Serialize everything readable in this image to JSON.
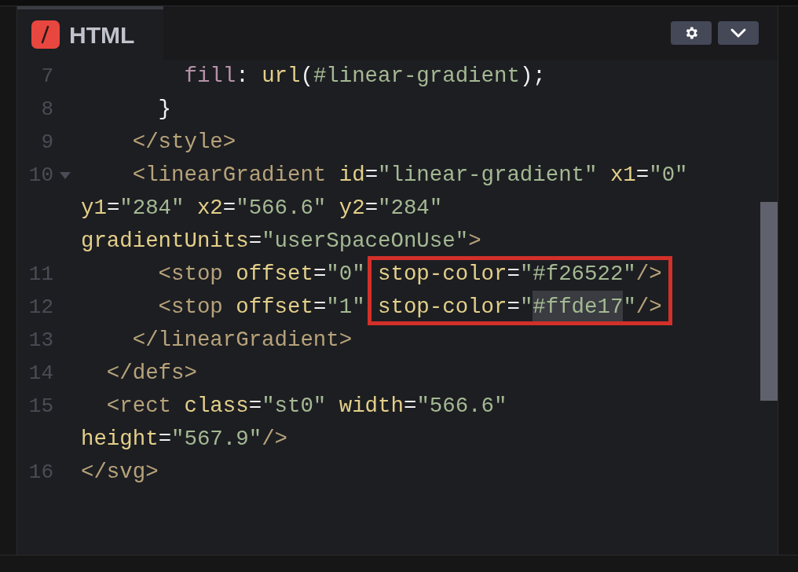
{
  "tab": {
    "label": "HTML",
    "selected": true
  },
  "toolbar": [
    {
      "kind": "settings"
    },
    {
      "kind": "collapse"
    }
  ],
  "lines": [
    {
      "number": "7",
      "tokens": [
        {
          "kind": "property",
          "text": "        fill"
        },
        {
          "kind": "punct",
          "text": ": "
        },
        {
          "kind": "func",
          "text": "url"
        },
        {
          "kind": "punct",
          "text": "("
        },
        {
          "kind": "string",
          "text": "#linear-gradient"
        },
        {
          "kind": "punct",
          "text": ");"
        }
      ]
    },
    {
      "number": "8",
      "tokens": [
        {
          "kind": "punct",
          "text": "      }"
        }
      ]
    },
    {
      "number": "9",
      "tokens": [
        {
          "kind": "tag",
          "text": "    </style>"
        }
      ]
    },
    {
      "number": "10",
      "foldable": true,
      "tokens": [
        {
          "kind": "tag",
          "text": "    <linearGradient "
        },
        {
          "kind": "attr",
          "text": "id"
        },
        {
          "kind": "punct",
          "text": "="
        },
        {
          "kind": "string",
          "text": "\"linear-gradient\" "
        },
        {
          "kind": "attr",
          "text": "x1"
        },
        {
          "kind": "punct",
          "text": "="
        },
        {
          "kind": "string",
          "text": "\"0\""
        }
      ]
    },
    {
      "tokens": [
        {
          "kind": "attr",
          "text": "y1"
        },
        {
          "kind": "punct",
          "text": "="
        },
        {
          "kind": "string",
          "text": "\"284\" "
        },
        {
          "kind": "attr",
          "text": "x2"
        },
        {
          "kind": "punct",
          "text": "="
        },
        {
          "kind": "string",
          "text": "\"566.6\" "
        },
        {
          "kind": "attr",
          "text": "y2"
        },
        {
          "kind": "punct",
          "text": "="
        },
        {
          "kind": "string",
          "text": "\"284\""
        }
      ]
    },
    {
      "tokens": [
        {
          "kind": "attr",
          "text": "gradientUnits"
        },
        {
          "kind": "punct",
          "text": "="
        },
        {
          "kind": "string",
          "text": "\"userSpaceOnUse\""
        },
        {
          "kind": "tag",
          "text": ">"
        }
      ]
    },
    {
      "number": "11",
      "tokens": [
        {
          "kind": "tag",
          "text": "      <stop "
        },
        {
          "kind": "attr",
          "text": "offset"
        },
        {
          "kind": "punct",
          "text": "="
        },
        {
          "kind": "string",
          "text": "\"0\" "
        }
      ],
      "boxed_tokens": [
        {
          "kind": "attr",
          "text": "stop-color"
        },
        {
          "kind": "punct",
          "text": "="
        },
        {
          "kind": "string",
          "text": "\"#f26522\""
        },
        {
          "kind": "tag",
          "text": "/>"
        }
      ]
    },
    {
      "number": "12",
      "tokens": [
        {
          "kind": "tag",
          "text": "      <stop "
        },
        {
          "kind": "attr",
          "text": "offset"
        },
        {
          "kind": "punct",
          "text": "="
        },
        {
          "kind": "string",
          "text": "\"1\" "
        }
      ],
      "boxed_tokens": [
        {
          "kind": "attr",
          "text": "stop-color"
        },
        {
          "kind": "punct",
          "text": "="
        },
        {
          "kind": "string",
          "text": "\""
        },
        {
          "kind": "string",
          "text": "#ffde17",
          "selected": true,
          "cursor": true
        },
        {
          "kind": "string",
          "text": "\""
        },
        {
          "kind": "tag",
          "text": "/>"
        }
      ]
    },
    {
      "number": "13",
      "tokens": [
        {
          "kind": "tag",
          "text": "    </linearGradient>"
        }
      ]
    },
    {
      "number": "14",
      "tokens": [
        {
          "kind": "tag",
          "text": "  </defs>"
        }
      ]
    },
    {
      "number": "15",
      "tokens": [
        {
          "kind": "tag",
          "text": "  <rect "
        },
        {
          "kind": "attr",
          "text": "class"
        },
        {
          "kind": "punct",
          "text": "="
        },
        {
          "kind": "string",
          "text": "\"st0\" "
        },
        {
          "kind": "attr",
          "text": "width"
        },
        {
          "kind": "punct",
          "text": "="
        },
        {
          "kind": "string",
          "text": "\"566.6\""
        }
      ]
    },
    {
      "tokens": [
        {
          "kind": "attr",
          "text": "height"
        },
        {
          "kind": "punct",
          "text": "="
        },
        {
          "kind": "string",
          "text": "\"567.9\""
        },
        {
          "kind": "tag",
          "text": "/>"
        }
      ]
    },
    {
      "number": "16",
      "tokens": [
        {
          "kind": "tag",
          "text": "</svg>"
        }
      ]
    }
  ]
}
